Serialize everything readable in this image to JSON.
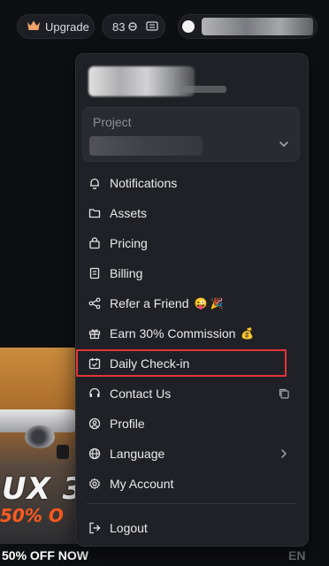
{
  "topbar": {
    "upgrade_label": "Upgrade",
    "credits": "83",
    "icons": [
      "crown-icon",
      "coin-icon",
      "ticket-icon",
      "user-avatar"
    ]
  },
  "promo": {
    "big_text": "UX 3",
    "discount_text": "50% O",
    "strip_text": "50% OFF NOW",
    "corner_text": "EN"
  },
  "menu": {
    "project": {
      "label": "Project"
    },
    "items": [
      {
        "label": "Notifications",
        "icon": "bell-icon"
      },
      {
        "label": "Assets",
        "icon": "folder-icon"
      },
      {
        "label": "Pricing",
        "icon": "shopping-bag-icon"
      },
      {
        "label": "Billing",
        "icon": "receipt-icon"
      },
      {
        "label": "Refer a Friend",
        "icon": "share-icon",
        "emoji": "😜 🎉"
      },
      {
        "label": "Earn 30% Commission",
        "icon": "gift-icon",
        "emoji": "💰"
      },
      {
        "label": "Daily Check-in",
        "icon": "calendar-check-icon"
      },
      {
        "label": "Contact Us",
        "icon": "headset-icon"
      },
      {
        "label": "Profile",
        "icon": "user-circle-icon"
      },
      {
        "label": "Language",
        "icon": "globe-icon"
      },
      {
        "label": "My Account",
        "icon": "gear-icon"
      },
      {
        "label": "Logout",
        "icon": "logout-icon"
      }
    ]
  },
  "colors": {
    "highlight": "#e1353b",
    "menu_bg": "#202126",
    "page_bg": "#0e0f12"
  }
}
